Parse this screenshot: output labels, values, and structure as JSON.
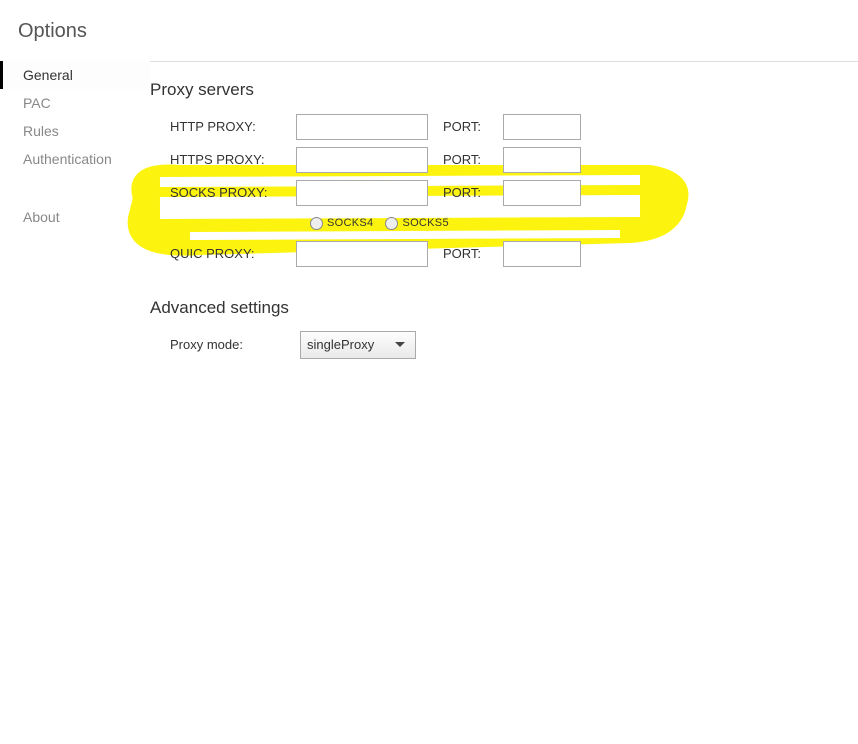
{
  "page_title": "Options",
  "sidebar": {
    "items": [
      {
        "label": "General",
        "active": true
      },
      {
        "label": "PAC",
        "active": false
      },
      {
        "label": "Rules",
        "active": false
      },
      {
        "label": "Authentication",
        "active": false
      }
    ],
    "about_label": "About"
  },
  "proxy_section": {
    "heading": "Proxy servers",
    "rows": [
      {
        "label": "HTTP PROXY:",
        "port_label": "PORT:",
        "value": "",
        "port_value": ""
      },
      {
        "label": "HTTPS PROXY:",
        "port_label": "PORT:",
        "value": "",
        "port_value": ""
      },
      {
        "label": "SOCKS PROXY:",
        "port_label": "PORT:",
        "value": "",
        "port_value": ""
      },
      {
        "label": "QUIC PROXY:",
        "port_label": "PORT:",
        "value": "",
        "port_value": ""
      }
    ],
    "socks_radios": {
      "socks4": "SOCKS4",
      "socks5": "SOCKS5"
    }
  },
  "advanced": {
    "heading": "Advanced settings",
    "proxy_mode_label": "Proxy mode:",
    "proxy_mode_value": "singleProxy"
  }
}
